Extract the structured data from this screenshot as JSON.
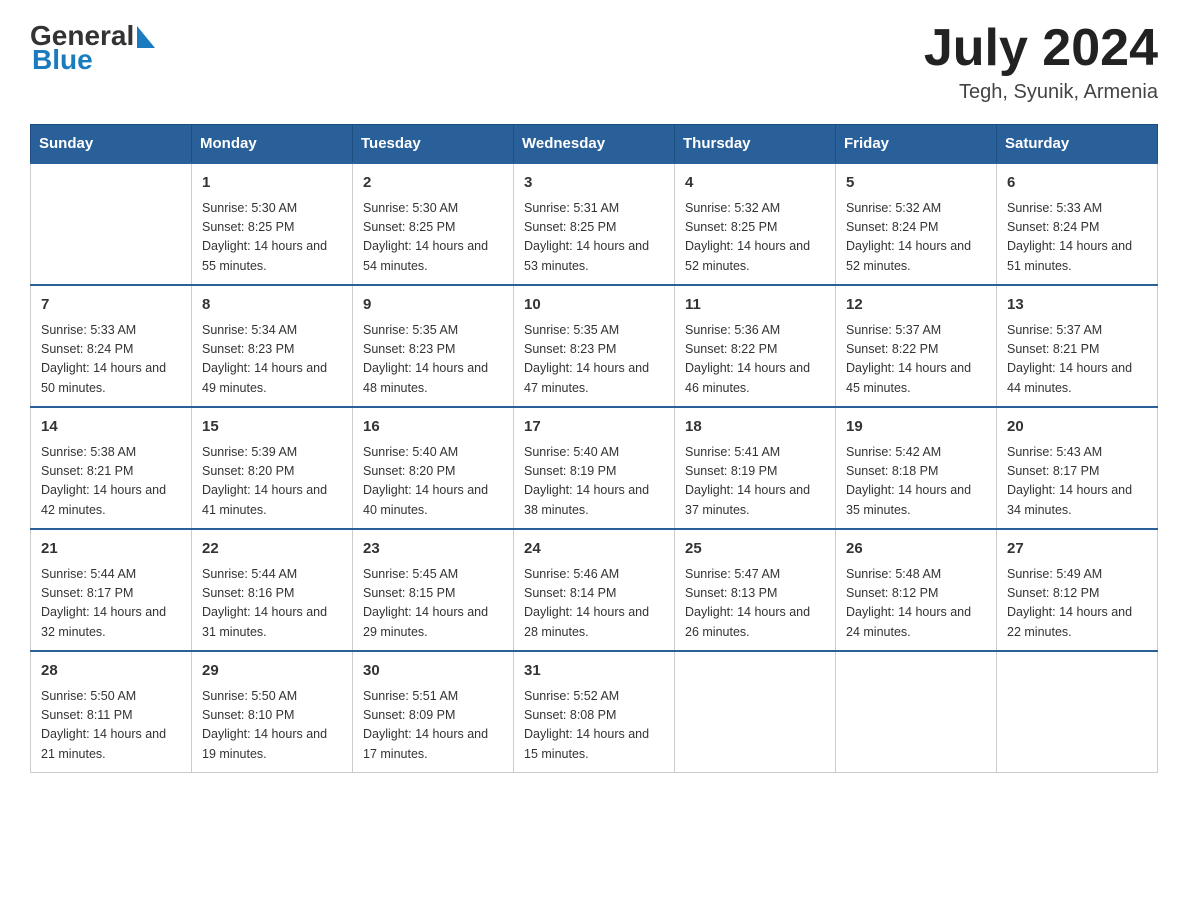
{
  "header": {
    "logo_general": "General",
    "logo_blue": "Blue",
    "month": "July 2024",
    "location": "Tegh, Syunik, Armenia"
  },
  "weekdays": [
    "Sunday",
    "Monday",
    "Tuesday",
    "Wednesday",
    "Thursday",
    "Friday",
    "Saturday"
  ],
  "weeks": [
    [
      {
        "day": "",
        "sunrise": "",
        "sunset": "",
        "daylight": ""
      },
      {
        "day": "1",
        "sunrise": "Sunrise: 5:30 AM",
        "sunset": "Sunset: 8:25 PM",
        "daylight": "Daylight: 14 hours and 55 minutes."
      },
      {
        "day": "2",
        "sunrise": "Sunrise: 5:30 AM",
        "sunset": "Sunset: 8:25 PM",
        "daylight": "Daylight: 14 hours and 54 minutes."
      },
      {
        "day": "3",
        "sunrise": "Sunrise: 5:31 AM",
        "sunset": "Sunset: 8:25 PM",
        "daylight": "Daylight: 14 hours and 53 minutes."
      },
      {
        "day": "4",
        "sunrise": "Sunrise: 5:32 AM",
        "sunset": "Sunset: 8:25 PM",
        "daylight": "Daylight: 14 hours and 52 minutes."
      },
      {
        "day": "5",
        "sunrise": "Sunrise: 5:32 AM",
        "sunset": "Sunset: 8:24 PM",
        "daylight": "Daylight: 14 hours and 52 minutes."
      },
      {
        "day": "6",
        "sunrise": "Sunrise: 5:33 AM",
        "sunset": "Sunset: 8:24 PM",
        "daylight": "Daylight: 14 hours and 51 minutes."
      }
    ],
    [
      {
        "day": "7",
        "sunrise": "Sunrise: 5:33 AM",
        "sunset": "Sunset: 8:24 PM",
        "daylight": "Daylight: 14 hours and 50 minutes."
      },
      {
        "day": "8",
        "sunrise": "Sunrise: 5:34 AM",
        "sunset": "Sunset: 8:23 PM",
        "daylight": "Daylight: 14 hours and 49 minutes."
      },
      {
        "day": "9",
        "sunrise": "Sunrise: 5:35 AM",
        "sunset": "Sunset: 8:23 PM",
        "daylight": "Daylight: 14 hours and 48 minutes."
      },
      {
        "day": "10",
        "sunrise": "Sunrise: 5:35 AM",
        "sunset": "Sunset: 8:23 PM",
        "daylight": "Daylight: 14 hours and 47 minutes."
      },
      {
        "day": "11",
        "sunrise": "Sunrise: 5:36 AM",
        "sunset": "Sunset: 8:22 PM",
        "daylight": "Daylight: 14 hours and 46 minutes."
      },
      {
        "day": "12",
        "sunrise": "Sunrise: 5:37 AM",
        "sunset": "Sunset: 8:22 PM",
        "daylight": "Daylight: 14 hours and 45 minutes."
      },
      {
        "day": "13",
        "sunrise": "Sunrise: 5:37 AM",
        "sunset": "Sunset: 8:21 PM",
        "daylight": "Daylight: 14 hours and 44 minutes."
      }
    ],
    [
      {
        "day": "14",
        "sunrise": "Sunrise: 5:38 AM",
        "sunset": "Sunset: 8:21 PM",
        "daylight": "Daylight: 14 hours and 42 minutes."
      },
      {
        "day": "15",
        "sunrise": "Sunrise: 5:39 AM",
        "sunset": "Sunset: 8:20 PM",
        "daylight": "Daylight: 14 hours and 41 minutes."
      },
      {
        "day": "16",
        "sunrise": "Sunrise: 5:40 AM",
        "sunset": "Sunset: 8:20 PM",
        "daylight": "Daylight: 14 hours and 40 minutes."
      },
      {
        "day": "17",
        "sunrise": "Sunrise: 5:40 AM",
        "sunset": "Sunset: 8:19 PM",
        "daylight": "Daylight: 14 hours and 38 minutes."
      },
      {
        "day": "18",
        "sunrise": "Sunrise: 5:41 AM",
        "sunset": "Sunset: 8:19 PM",
        "daylight": "Daylight: 14 hours and 37 minutes."
      },
      {
        "day": "19",
        "sunrise": "Sunrise: 5:42 AM",
        "sunset": "Sunset: 8:18 PM",
        "daylight": "Daylight: 14 hours and 35 minutes."
      },
      {
        "day": "20",
        "sunrise": "Sunrise: 5:43 AM",
        "sunset": "Sunset: 8:17 PM",
        "daylight": "Daylight: 14 hours and 34 minutes."
      }
    ],
    [
      {
        "day": "21",
        "sunrise": "Sunrise: 5:44 AM",
        "sunset": "Sunset: 8:17 PM",
        "daylight": "Daylight: 14 hours and 32 minutes."
      },
      {
        "day": "22",
        "sunrise": "Sunrise: 5:44 AM",
        "sunset": "Sunset: 8:16 PM",
        "daylight": "Daylight: 14 hours and 31 minutes."
      },
      {
        "day": "23",
        "sunrise": "Sunrise: 5:45 AM",
        "sunset": "Sunset: 8:15 PM",
        "daylight": "Daylight: 14 hours and 29 minutes."
      },
      {
        "day": "24",
        "sunrise": "Sunrise: 5:46 AM",
        "sunset": "Sunset: 8:14 PM",
        "daylight": "Daylight: 14 hours and 28 minutes."
      },
      {
        "day": "25",
        "sunrise": "Sunrise: 5:47 AM",
        "sunset": "Sunset: 8:13 PM",
        "daylight": "Daylight: 14 hours and 26 minutes."
      },
      {
        "day": "26",
        "sunrise": "Sunrise: 5:48 AM",
        "sunset": "Sunset: 8:12 PM",
        "daylight": "Daylight: 14 hours and 24 minutes."
      },
      {
        "day": "27",
        "sunrise": "Sunrise: 5:49 AM",
        "sunset": "Sunset: 8:12 PM",
        "daylight": "Daylight: 14 hours and 22 minutes."
      }
    ],
    [
      {
        "day": "28",
        "sunrise": "Sunrise: 5:50 AM",
        "sunset": "Sunset: 8:11 PM",
        "daylight": "Daylight: 14 hours and 21 minutes."
      },
      {
        "day": "29",
        "sunrise": "Sunrise: 5:50 AM",
        "sunset": "Sunset: 8:10 PM",
        "daylight": "Daylight: 14 hours and 19 minutes."
      },
      {
        "day": "30",
        "sunrise": "Sunrise: 5:51 AM",
        "sunset": "Sunset: 8:09 PM",
        "daylight": "Daylight: 14 hours and 17 minutes."
      },
      {
        "day": "31",
        "sunrise": "Sunrise: 5:52 AM",
        "sunset": "Sunset: 8:08 PM",
        "daylight": "Daylight: 14 hours and 15 minutes."
      },
      {
        "day": "",
        "sunrise": "",
        "sunset": "",
        "daylight": ""
      },
      {
        "day": "",
        "sunrise": "",
        "sunset": "",
        "daylight": ""
      },
      {
        "day": "",
        "sunrise": "",
        "sunset": "",
        "daylight": ""
      }
    ]
  ]
}
